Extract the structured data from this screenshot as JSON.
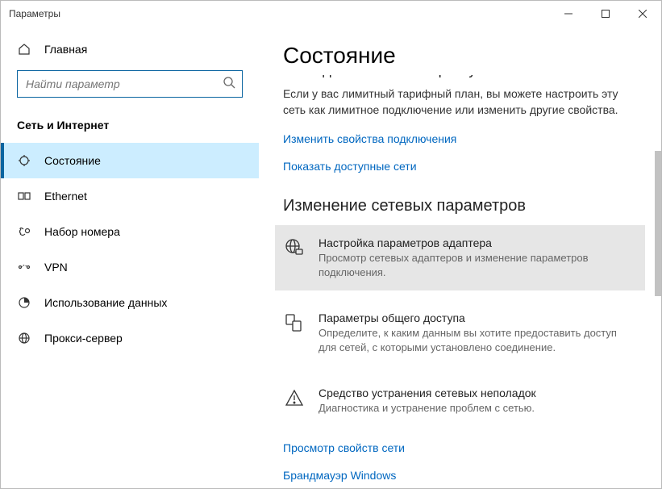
{
  "window": {
    "title": "Параметры"
  },
  "sidebar": {
    "home": "Главная",
    "search_placeholder": "Найти параметр",
    "section": "Сеть и Интернет",
    "items": [
      {
        "label": "Состояние"
      },
      {
        "label": "Ethernet"
      },
      {
        "label": "Набор номера"
      },
      {
        "label": "VPN"
      },
      {
        "label": "Использование данных"
      },
      {
        "label": "Прокси-сервер"
      }
    ]
  },
  "main": {
    "heading": "Состояние",
    "cutoff_line": "Вы подключены к Интернету",
    "intro": "Если у вас лимитный тарифный план, вы можете настроить эту сеть как лимитное подключение или изменить другие свойства.",
    "link_change_props": "Изменить свойства подключения",
    "link_show_nets": "Показать доступные сети",
    "sub_heading": "Изменение сетевых параметров",
    "options": [
      {
        "title": "Настройка параметров адаптера",
        "desc": "Просмотр сетевых адаптеров и изменение параметров подключения."
      },
      {
        "title": "Параметры общего доступа",
        "desc": "Определите, к каким данным вы хотите предоставить доступ для сетей, с которыми установлено соединение."
      },
      {
        "title": "Средство устранения сетевых неполадок",
        "desc": "Диагностика и устранение проблем с сетью."
      }
    ],
    "link_view_props": "Просмотр свойств сети",
    "link_firewall": "Брандмауэр Windows"
  }
}
